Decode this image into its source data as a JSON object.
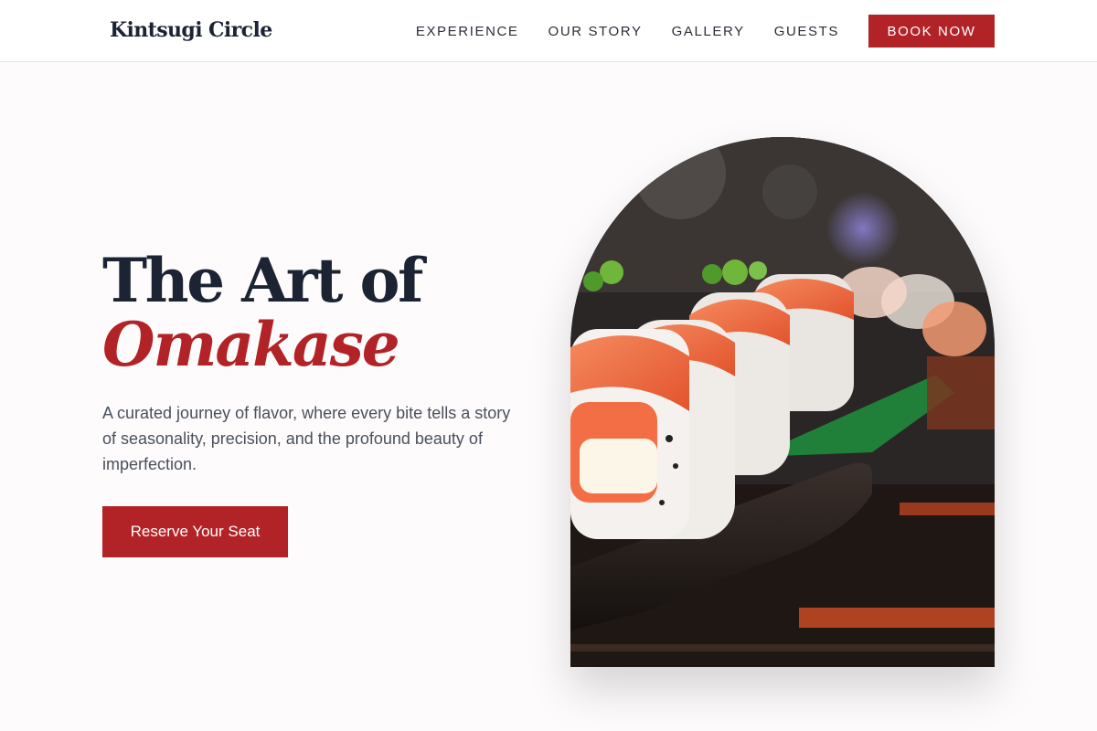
{
  "header": {
    "brand": "Kintsugi Circle",
    "nav": [
      {
        "label": "EXPERIENCE"
      },
      {
        "label": "OUR STORY"
      },
      {
        "label": "GALLERY"
      },
      {
        "label": "GUESTS"
      }
    ],
    "cta_label": "BOOK NOW"
  },
  "hero": {
    "title_line1": "The Art of",
    "title_line2": "Omakase",
    "description": "A curated journey of flavor, where every bite tells a story of seasonality, precision, and the profound beauty of imperfection.",
    "button_label": "Reserve Your Seat",
    "image_alt": "sushi-rolls-photo"
  },
  "colors": {
    "accent": "#b22327",
    "heading": "#1c2433",
    "background": "#fdfbfb"
  }
}
